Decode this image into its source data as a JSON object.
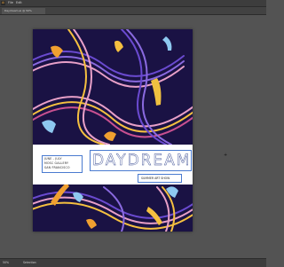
{
  "app": {
    "logo": "Ai"
  },
  "menubar": {
    "items": [
      "File",
      "Edit"
    ]
  },
  "tabbar": {
    "active_tab": "Daydream.ai @ 50%"
  },
  "poster": {
    "event_lines": [
      "JUNE - JULY",
      "MOSC GALLERY",
      "SAN FRANCISCO"
    ],
    "title": "DAYDREAM",
    "subtitle": "SUMMER ART SHOW"
  },
  "statusbar": {
    "zoom": "50%",
    "status": "Selection"
  },
  "colors": {
    "workspace": "#535353",
    "poster_bg": "#1a1244",
    "figure_orange": "#f0a030",
    "figure_blue": "#8ec8f0",
    "wave_pink": "#e8a0c8",
    "wave_purple": "#6a4ad0",
    "wave_yellow": "#f5c040"
  },
  "icons": {
    "cursor": "cross-cursor-icon"
  }
}
